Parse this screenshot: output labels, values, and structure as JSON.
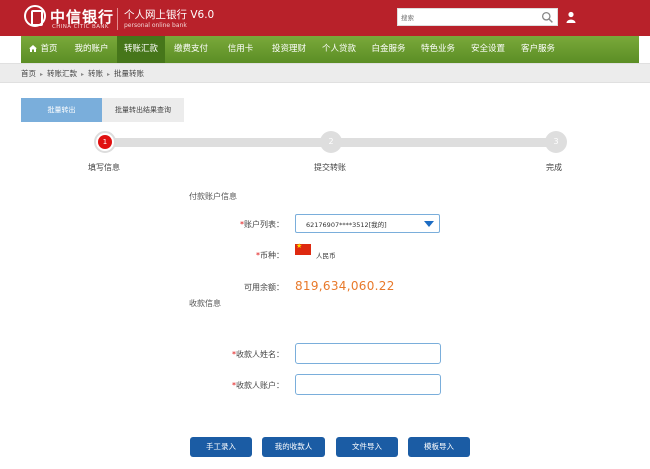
{
  "header": {
    "bank_name_cn": "中信银行",
    "bank_name_en": "CHINA CITIC BANK",
    "system_title": "个人网上银行 V6.0",
    "system_subtitle": "personal online bank",
    "search_placeholder": "搜索"
  },
  "nav": {
    "items": [
      "首页",
      "我的账户",
      "转账汇款",
      "缴费支付",
      "信用卡",
      "投资理财",
      "个人贷款",
      "白金服务",
      "特色业务",
      "安全设置",
      "客户服务"
    ],
    "active_index": 2
  },
  "breadcrumb": [
    "首页",
    "转账汇款",
    "转账",
    "批量转账"
  ],
  "tabs": [
    "批量转出",
    "批量转出结果查询"
  ],
  "steps": [
    {
      "number": "1",
      "label": "填写信息"
    },
    {
      "number": "2",
      "label": "提交转账"
    },
    {
      "number": "3",
      "label": "完成"
    }
  ],
  "payer": {
    "section_title": "付款账户信息",
    "account_label": "账户列表：",
    "account_value": "62176907****3512[我的]",
    "currency_label": "币种：",
    "currency_value": "人民币",
    "balance_label": "可用余额：",
    "balance_value": "819,634,060.22"
  },
  "payee": {
    "section_title": "收款信息",
    "name_label": "收款人姓名：",
    "account_label": "收款人账户："
  },
  "buttons": [
    "手工录入",
    "我的收款人",
    "文件导入",
    "模板导入"
  ],
  "colors": {
    "header_red": "#b8212a",
    "nav_green": "#5b8e25",
    "accent_blue": "#7aaedb",
    "button_blue": "#1b5ca4",
    "balance_orange": "#e8792a"
  }
}
